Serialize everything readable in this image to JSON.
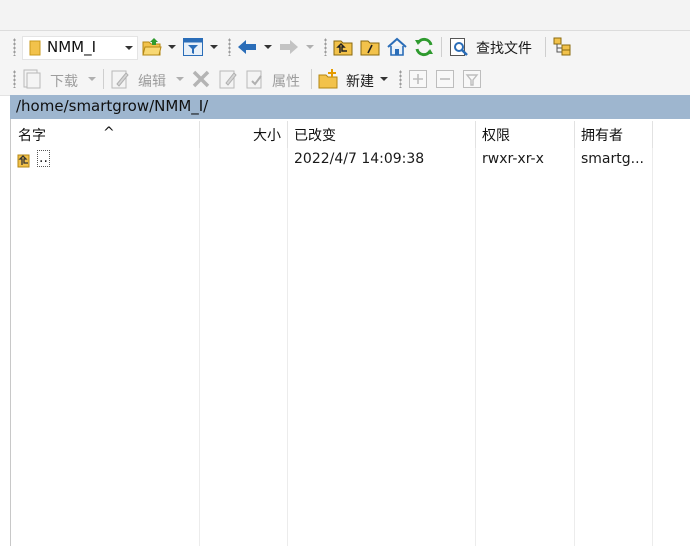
{
  "window": {
    "path": "/home/smartgrow/NMM_I/"
  },
  "toolbar1": {
    "directory_combo_value": "NMM_I",
    "find_files_label": "查找文件"
  },
  "toolbar2": {
    "download_label": "下载",
    "edit_label": "编辑",
    "properties_label": "属性",
    "new_label": "新建"
  },
  "columns": {
    "name": "名字",
    "size": "大小",
    "modified": "已改变",
    "permissions": "权限",
    "owner": "拥有者"
  },
  "rows": [
    {
      "name": "..",
      "size": "",
      "modified": "2022/4/7 14:09:38",
      "permissions": "rwxr-xr-x",
      "owner": "smartg..."
    }
  ],
  "icons": {
    "open_folder": "open-folder-icon",
    "filter": "filter-icon",
    "back": "back-arrow-icon",
    "forward": "forward-arrow-icon",
    "parent_dir": "parent-directory-icon",
    "root_dir": "root-directory-icon",
    "home": "home-icon",
    "refresh": "refresh-icon",
    "find": "find-files-icon",
    "tree": "directory-tree-icon"
  },
  "colors": {
    "path_bar": "#9eb6cf",
    "folder": "#f2c24b",
    "home_icon": "#2a6db8",
    "refresh_icon": "#2e9a2e",
    "back_arrow": "#2a6db8"
  }
}
